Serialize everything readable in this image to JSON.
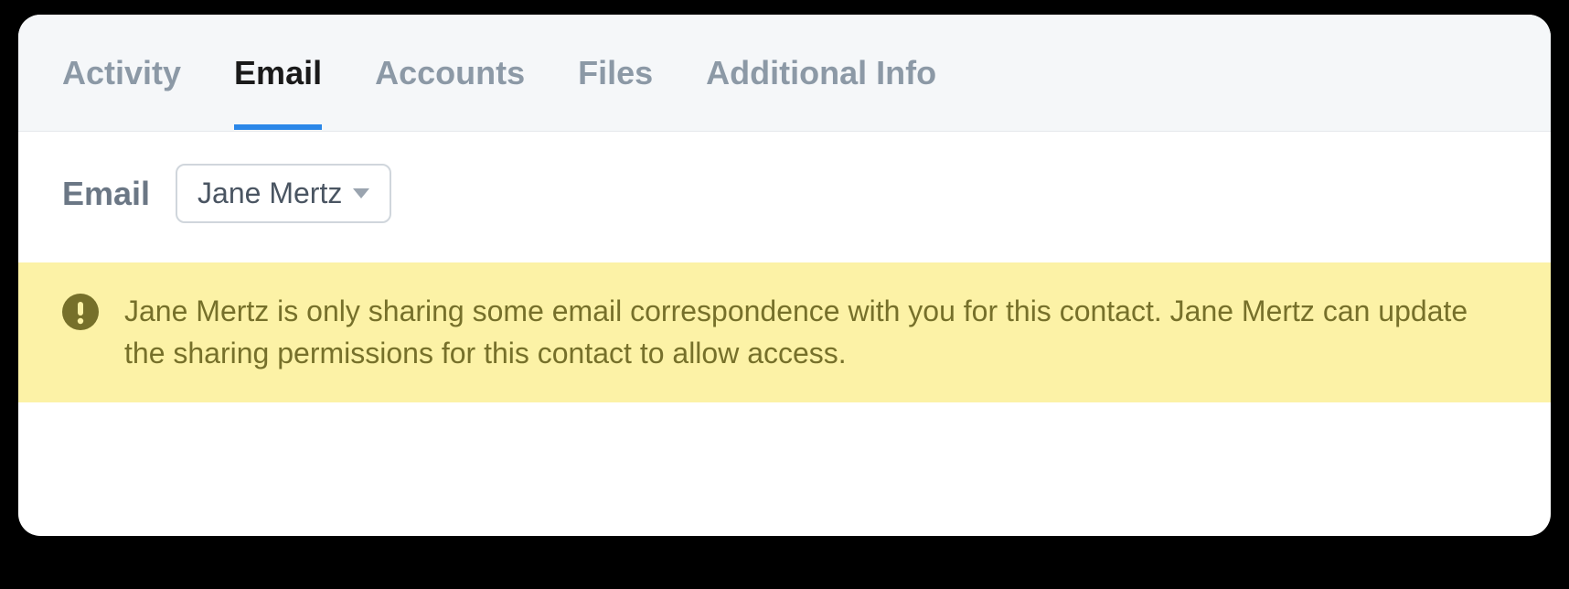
{
  "tabs": [
    {
      "label": "Activity",
      "active": false
    },
    {
      "label": "Email",
      "active": true
    },
    {
      "label": "Accounts",
      "active": false
    },
    {
      "label": "Files",
      "active": false
    },
    {
      "label": "Additional Info",
      "active": false
    }
  ],
  "section": {
    "title": "Email",
    "dropdown": {
      "selected": "Jane Mertz"
    }
  },
  "notice": {
    "text": "Jane Mertz is only sharing some email correspondence with you for this contact. Jane Mertz can update the sharing permissions for this contact to allow access."
  }
}
